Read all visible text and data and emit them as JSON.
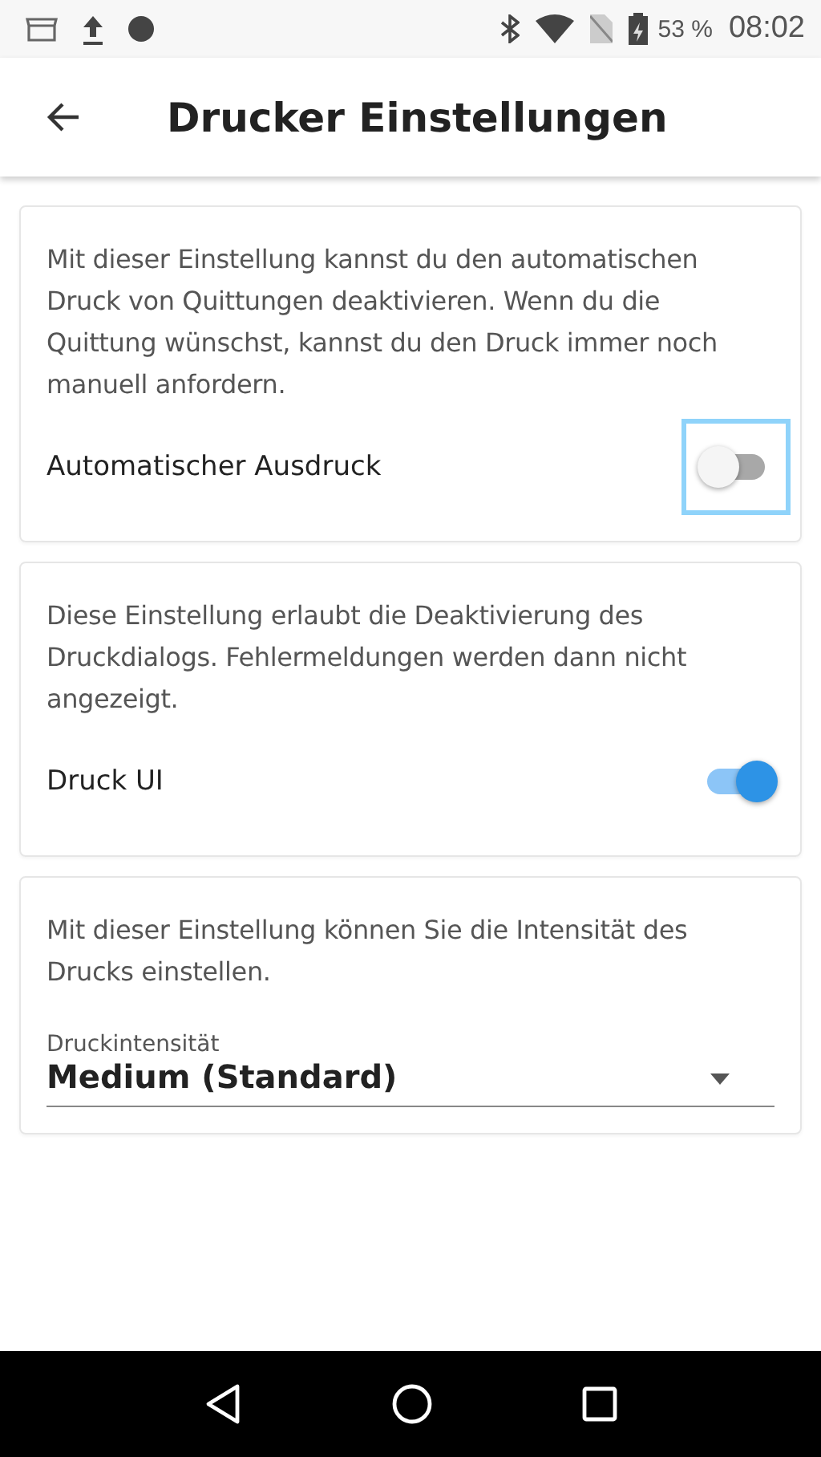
{
  "status_bar": {
    "battery": "53 %",
    "time": "08:02"
  },
  "app_bar": {
    "title": "Drucker Einstellungen"
  },
  "settings": [
    {
      "kind": "toggle",
      "description": "Mit dieser Einstellung kannst du den automatischen Druck von Quittungen deaktivieren. Wenn du die Quittung wünschst, kannst du den Druck immer noch manuell anfordern.",
      "label": "Automatischer Ausdruck",
      "on": false,
      "focused": true
    },
    {
      "kind": "toggle",
      "description": "Diese Einstellung erlaubt die Deaktivierung des Druckdialogs. Fehlermeldungen werden dann nicht angezeigt.",
      "label": "Druck UI",
      "on": true,
      "focused": false
    },
    {
      "kind": "select",
      "description": "Mit dieser Einstellung können Sie die Intensität des Drucks einstellen.",
      "label": "Druckintensität",
      "value": "Medium (Standard)"
    }
  ]
}
